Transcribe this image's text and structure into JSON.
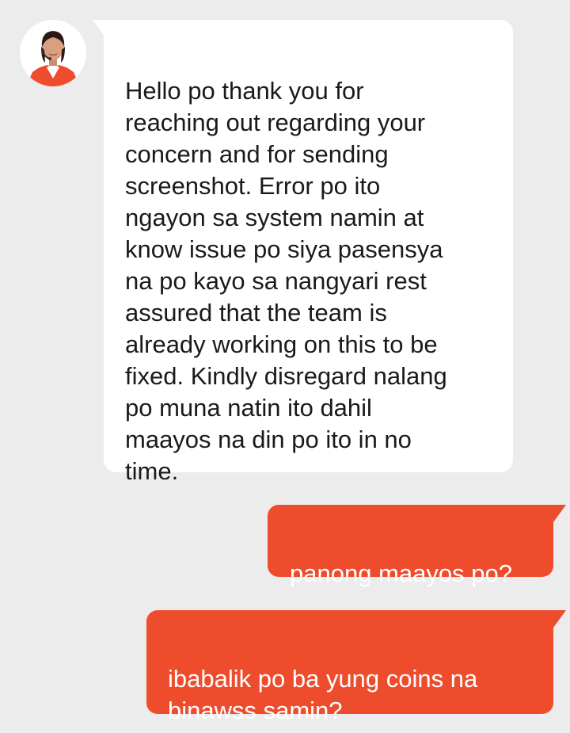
{
  "conversation": {
    "agent": {
      "avatar_label": "support agent avatar",
      "message": "Hello po thank you for\nreaching out regarding your\nconcern and for sending\nscreenshot. Error po ito\nngayon sa system namin at\nknow issue po siya pasensya\nna po kayo sa nangyari rest\nassured that the team is\nalready working on this to be\nfixed. Kindly disregard nalang\npo muna natin ito dahil\nmaayos na din po ito in no\ntime."
    },
    "user_messages": [
      {
        "text": "panong maayos po?"
      },
      {
        "text": "ibabalik po ba yung coins na\nbinawss samin?"
      }
    ]
  },
  "colors": {
    "background": "#ececec",
    "agent_bubble": "#ffffff",
    "user_bubble": "#ee4d2d",
    "user_text": "#ffffff",
    "agent_text": "#1a1a1a"
  }
}
